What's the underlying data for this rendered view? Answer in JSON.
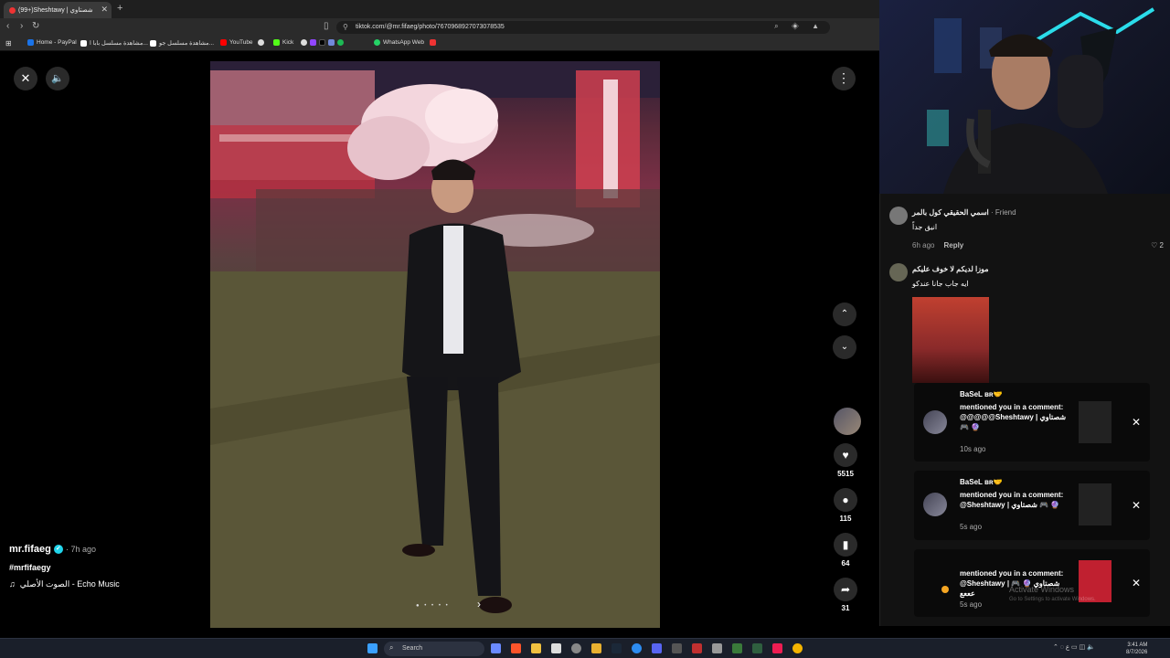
{
  "browser": {
    "tab_title": "(99+)Sheshtawy | شصتاوي",
    "url": "tiktok.com/@mr.fifaeg/photo/7670968927073078535",
    "bookmarks": [
      "Home - PayPal",
      "مشاهدة مسلسل بابا ا...",
      "مشاهدة مسلسل جو...",
      "YouTube",
      "Kick",
      "WhatsApp Web"
    ]
  },
  "post": {
    "username": "mr.fifaeg",
    "posted_ago": "· 7h ago",
    "hashtag": "#mrfifaegy",
    "music": "الصوت الأصلي - Echo Music",
    "likes": "5515",
    "comments": "115",
    "saves": "64",
    "shares": "31"
  },
  "comments": [
    {
      "name": "اسمي الحقيقي كول بالمر",
      "relation": "· Friend",
      "text": "انيق جداً",
      "ago": "6h ago",
      "reply": "Reply",
      "likes": "2"
    },
    {
      "name": "موزا لديكم لا خوف عليكم",
      "text": "ايه جاب جانا عندكو"
    }
  ],
  "notifications": [
    {
      "who": "BaSeL ʙʀ🤝",
      "msg": "mentioned you in a comment: @@@@@Sheshtawy | شصتاوي 🎮 🔮",
      "time": "10s ago"
    },
    {
      "who": "BaSeL ʙʀ🤝",
      "msg": "mentioned you in a comment: @Sheshtawy | شصتاوي 🎮 🔮",
      "time": "5s ago"
    },
    {
      "who": "",
      "msg": "mentioned you in a comment: @Sheshtawy | شصتاوي 🔮 🎮 عععع",
      "time": "5s ago"
    }
  ],
  "windows": {
    "watermark": "Activate Windows",
    "watermark_sub": "Go to Settings to activate Windows.",
    "search": "Search",
    "time": "3:41 AM",
    "date": "8/7/2026"
  }
}
